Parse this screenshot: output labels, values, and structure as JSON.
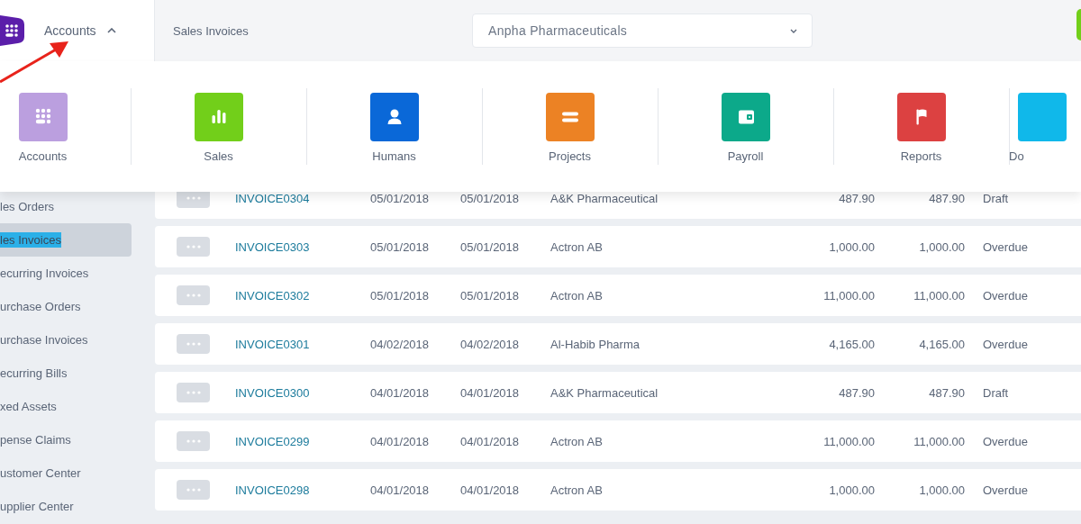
{
  "header": {
    "module": {
      "label": "Accounts",
      "expanded": true
    },
    "page_title": "Sales Invoices",
    "company_select": {
      "value": "Anpha Pharmaceuticals"
    }
  },
  "apps_menu": [
    {
      "label": "Accounts",
      "kind": "keypad",
      "color": "#bb9fdf"
    },
    {
      "label": "Sales",
      "kind": "bars",
      "color": "#72cf1a"
    },
    {
      "label": "Humans",
      "kind": "person",
      "color": "#0a68d8"
    },
    {
      "label": "Projects",
      "kind": "lines",
      "color": "#ec8224"
    },
    {
      "label": "Payroll",
      "kind": "wallet",
      "color": "#0ca98a"
    },
    {
      "label": "Reports",
      "kind": "flag",
      "color": "#dc4141"
    },
    {
      "label": "Do",
      "kind": "blank",
      "color": "#10b8ea"
    }
  ],
  "sidebar": {
    "items": [
      {
        "label": "les Orders",
        "selected": false
      },
      {
        "label": "les Invoices",
        "selected": true
      },
      {
        "label": "ecurring Invoices",
        "selected": false
      },
      {
        "label": "urchase Orders",
        "selected": false
      },
      {
        "label": "urchase Invoices",
        "selected": false
      },
      {
        "label": "ecurring Bills",
        "selected": false
      },
      {
        "label": "xed Assets",
        "selected": false
      },
      {
        "label": "pense Claims",
        "selected": false
      },
      {
        "label": "ustomer Center",
        "selected": false
      },
      {
        "label": "upplier Center",
        "selected": false
      }
    ]
  },
  "table": {
    "rows": [
      {
        "number": "INVOICE0304",
        "date": "05/01/2018",
        "due_date": "05/01/2018",
        "customer": "A&K Pharmaceutical",
        "amount": "487.90",
        "balance": "487.90",
        "status": "Draft"
      },
      {
        "number": "INVOICE0303",
        "date": "05/01/2018",
        "due_date": "05/01/2018",
        "customer": "Actron AB",
        "amount": "1,000.00",
        "balance": "1,000.00",
        "status": "Overdue"
      },
      {
        "number": "INVOICE0302",
        "date": "05/01/2018",
        "due_date": "05/01/2018",
        "customer": "Actron AB",
        "amount": "11,000.00",
        "balance": "11,000.00",
        "status": "Overdue"
      },
      {
        "number": "INVOICE0301",
        "date": "04/02/2018",
        "due_date": "04/02/2018",
        "customer": "Al-Habib Pharma",
        "amount": "4,165.00",
        "balance": "4,165.00",
        "status": "Overdue"
      },
      {
        "number": "INVOICE0300",
        "date": "04/01/2018",
        "due_date": "04/01/2018",
        "customer": "A&K Pharmaceutical",
        "amount": "487.90",
        "balance": "487.90",
        "status": "Draft"
      },
      {
        "number": "INVOICE0299",
        "date": "04/01/2018",
        "due_date": "04/01/2018",
        "customer": "Actron AB",
        "amount": "11,000.00",
        "balance": "11,000.00",
        "status": "Overdue"
      },
      {
        "number": "INVOICE0298",
        "date": "04/01/2018",
        "due_date": "04/01/2018",
        "customer": "Actron AB",
        "amount": "1,000.00",
        "balance": "1,000.00",
        "status": "Overdue"
      }
    ]
  }
}
